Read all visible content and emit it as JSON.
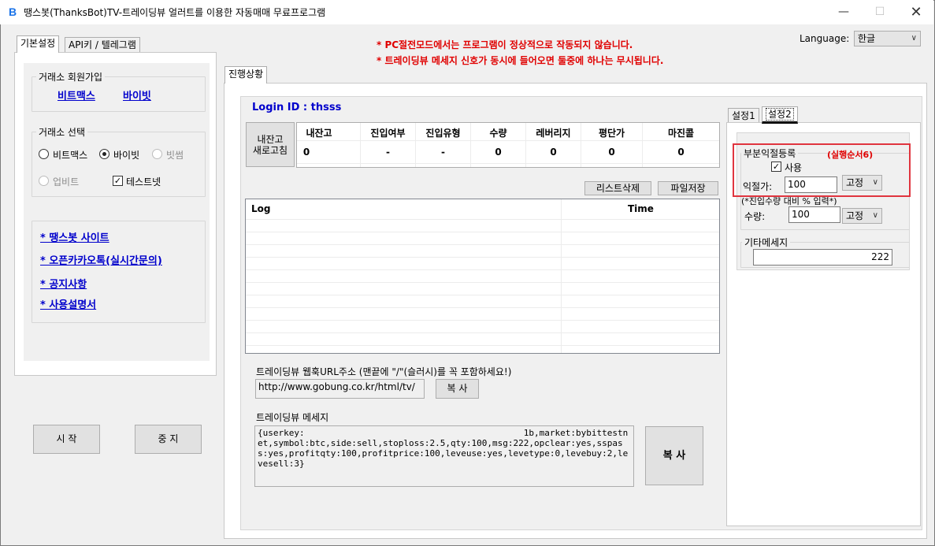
{
  "window": {
    "title": "땡스봇(ThanksBot)TV-트레이딩뷰 얼러트를 이용한 자동매매 무료프로그램",
    "icon": "B"
  },
  "notices": [
    "* PC절전모드에서는 프로그램이 정상적으로 작동되지 않습니다.",
    "* 트레이딩뷰 메세지 신호가 동시에 들어오면 둘중에 하나는 무시됩니다."
  ],
  "language": {
    "label": "Language:",
    "value": "한글"
  },
  "left_tabs": [
    "기본설정",
    "API키 / 텔레그램"
  ],
  "signup": {
    "legend": "거래소 회원가입",
    "links": [
      "비트맥스",
      "바이빗"
    ]
  },
  "exchange_select": {
    "legend": "거래소 선택",
    "options": [
      {
        "label": "비트맥스",
        "checked": false,
        "disabled": false
      },
      {
        "label": "바이빗",
        "checked": true,
        "disabled": false
      },
      {
        "label": "빗썸",
        "checked": false,
        "disabled": true
      },
      {
        "label": "업비트",
        "checked": false,
        "disabled": true
      }
    ],
    "testnet": {
      "label": "테스트넷",
      "checked": true
    }
  },
  "site_links": [
    "* 땡스봇 사이트",
    "* 오픈카카오톡(실시간문의)",
    "* 공지사항",
    "* 사용설명서"
  ],
  "controls": {
    "start": "시 작",
    "stop": "중 지"
  },
  "progress_tab": "진행상황",
  "login": {
    "label": "Login ID : thsss"
  },
  "refresh_button": "내잔고\n새로고침",
  "balance_table": {
    "headers": [
      "내잔고",
      "진입여부",
      "진입유형",
      "수량",
      "레버리지",
      "평단가",
      "마진콜"
    ],
    "values": [
      "0",
      "-",
      "-",
      "0",
      "0",
      "0",
      "0"
    ]
  },
  "list_buttons": {
    "delete": "리스트삭제",
    "save": "파일저장"
  },
  "log_table": {
    "headers": [
      "Log",
      "Time"
    ]
  },
  "webhook": {
    "label": "트레이딩뷰 웹훅URL주소 (맨끝에 \"/\"(슬러시)를 꼭 포함하세요!)",
    "value": "http://www.gobung.co.kr/html/tv/",
    "copy": "복 사"
  },
  "message": {
    "label": "트레이딩뷰 메세지",
    "value": "{userkey:                                          1b,market:bybittestnet,symbol:btc,side:sell,stoploss:2.5,qty:100,msg:222,opclear:yes,sspass:yes,profitqty:100,profitprice:100,leveuse:yes,levetype:0,levebuy:2,levesell:3}",
    "copy": "복 사"
  },
  "right_tabs": [
    "설정1",
    "설정2"
  ],
  "partial_profit": {
    "legend": "부분익절등록",
    "annotation": "(실행순서6)",
    "use": {
      "label": "사용",
      "checked": true
    },
    "price_label": "익절가:",
    "price_value": "100",
    "price_mode": "고정",
    "qty_note": "(*진입수량 대비 % 입력*)",
    "qty_label": "수량:",
    "qty_value": "100",
    "qty_mode": "고정"
  },
  "other_message": {
    "legend": "기타메세지",
    "value": "222"
  },
  "colors": {
    "accent_red": "#e00000",
    "link_blue": "#0000cc",
    "highlight_box": "#e0353f"
  }
}
